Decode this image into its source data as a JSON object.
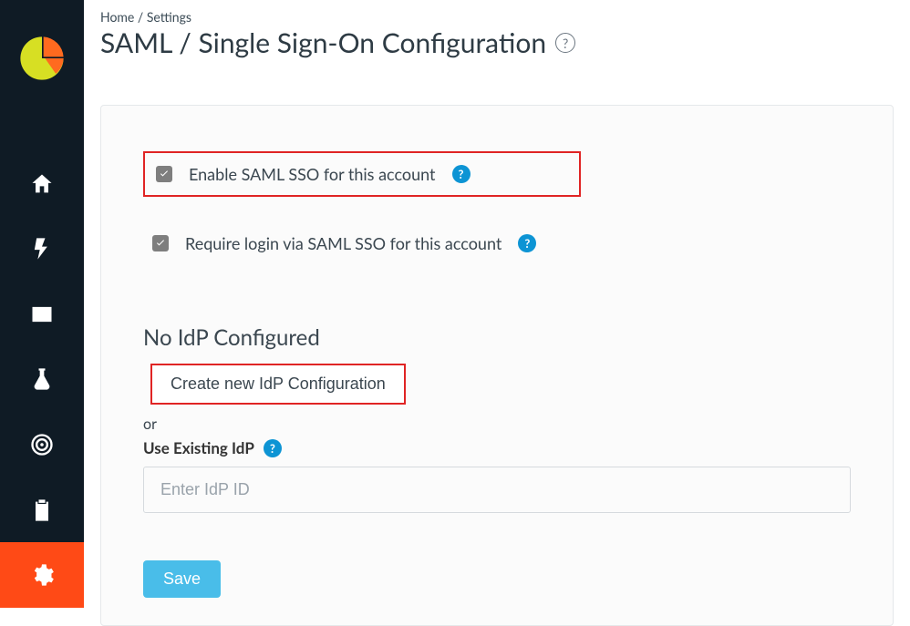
{
  "breadcrumb": {
    "home": "Home",
    "settings": "Settings",
    "separator": " / "
  },
  "page": {
    "title": "SAML / Single Sign-On Configuration"
  },
  "options": {
    "enable_label": "Enable SAML SSO for this account",
    "enable_checked": true,
    "require_label": "Require login via SAML SSO for this account",
    "require_checked": true
  },
  "idp": {
    "section_title": "No IdP Configured",
    "create_label": "Create new IdP Configuration",
    "or": "or",
    "use_existing_label": "Use Existing IdP",
    "input_placeholder": "Enter IdP ID",
    "input_value": ""
  },
  "actions": {
    "save_label": "Save"
  },
  "icons": {
    "help_glyph": "?",
    "help_tip_glyph": "?"
  },
  "colors": {
    "sidebar_bg": "#0f1b25",
    "accent_active": "#ff4a16",
    "highlight_border": "#e02424",
    "help_blue": "#0d94d4",
    "save_bg": "#49bde9"
  }
}
